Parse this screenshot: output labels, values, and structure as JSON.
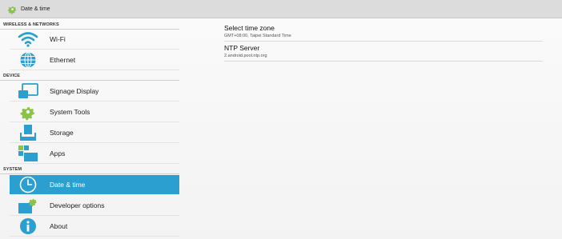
{
  "window": {
    "title": "Date & time",
    "icon": "gear-icon"
  },
  "sidebar": {
    "sections": [
      {
        "header": "WIRELESS & NETWORKS"
      },
      {
        "header": "DEVICE"
      },
      {
        "header": "SYSTEM"
      }
    ],
    "items": [
      {
        "label": "Wi-Fi",
        "icon": "wifi-icon"
      },
      {
        "label": "Ethernet",
        "icon": "globe-icon"
      },
      {
        "label": "Signage Display",
        "icon": "display-icon"
      },
      {
        "label": "System Tools",
        "icon": "gear-icon"
      },
      {
        "label": "Storage",
        "icon": "storage-icon"
      },
      {
        "label": "Apps",
        "icon": "apps-icon"
      },
      {
        "label": "Date & time",
        "icon": "clock-icon",
        "selected": true
      },
      {
        "label": "Developer options",
        "icon": "developer-icon"
      },
      {
        "label": "About",
        "icon": "info-icon"
      }
    ]
  },
  "settings": [
    {
      "name": "Select time zone",
      "value": "GMT+08:00, Taipei Standard Time"
    },
    {
      "name": "NTP Server",
      "value": "2.android.pool.ntp.org"
    }
  ],
  "colors": {
    "accent": "#2a9fd0",
    "icon_blue": "#2a9fd0",
    "icon_green": "#8bc34a",
    "titlebar": "#dcdcdc"
  }
}
